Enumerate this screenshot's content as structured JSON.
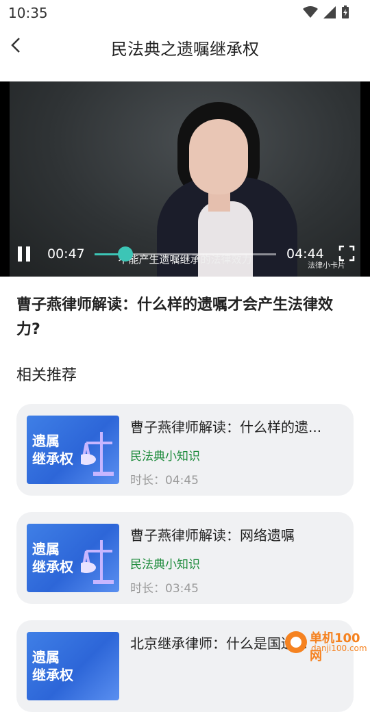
{
  "status_bar": {
    "time": "10:35"
  },
  "app_bar": {
    "title": "民法典之遗嘱继承权"
  },
  "player": {
    "current_time": "00:47",
    "total_time": "04:44",
    "progress": 0.17,
    "subtitle": "不能产生遗嘱继承的法律效力",
    "watermark": "法律小卡片",
    "accent_color": "#3cc5b6"
  },
  "video": {
    "title": "曹子燕律师解读：什么样的遗嘱才会产生法律效力?"
  },
  "related": {
    "heading": "相关推荐",
    "items": [
      {
        "thumb_text": "遗属继承权",
        "thumb_line1": "遗属",
        "thumb_line2": "继承权",
        "title": "曹子燕律师解读：什么样的遗...",
        "tag": "民法典小知识",
        "duration": "时长：04:45"
      },
      {
        "thumb_text": "遗属继承权",
        "thumb_line1": "遗属",
        "thumb_line2": "继承权",
        "title": "曹子燕律师解读：网络遗嘱",
        "tag": "民法典小知识",
        "duration": "时长：03:45"
      },
      {
        "thumb_text": "遗属继承权",
        "thumb_line1": "遗属",
        "thumb_line2": "继承权",
        "title": "北京继承律师：什么是国遗...",
        "tag": "",
        "duration": ""
      }
    ]
  },
  "watermark_site": {
    "name": "单机100网",
    "url": "danji100.com"
  }
}
